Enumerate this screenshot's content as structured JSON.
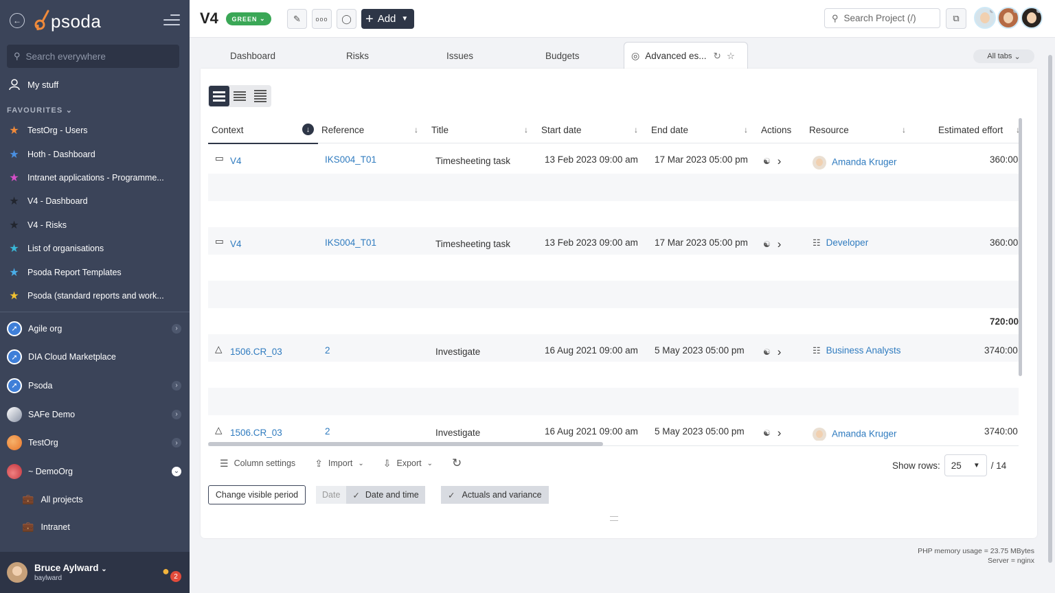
{
  "sidebar": {
    "logo_text": "psoda",
    "search_placeholder": "Search everywhere",
    "my_stuff": "My stuff",
    "favourites_heading": "FAVOURITES",
    "favourites": [
      {
        "label": "TestOrg - Users",
        "color": "#f08a3a"
      },
      {
        "label": "Hoth - Dashboard",
        "color": "#4a90e2"
      },
      {
        "label": "Intranet applications - Programme...",
        "color": "#d64fc8"
      },
      {
        "label": "V4 - Dashboard",
        "color": "#2a2f3a"
      },
      {
        "label": "V4 - Risks",
        "color": "#2a2f3a"
      },
      {
        "label": "List of organisations",
        "color": "#39b8d8"
      },
      {
        "label": "Psoda Report Templates",
        "color": "#4aaee8"
      },
      {
        "label": "Psoda (standard reports and work...",
        "color": "#f2c230"
      }
    ],
    "orgs": [
      {
        "label": "Agile org",
        "icon_color": "#3f7fd8",
        "expanded": false
      },
      {
        "label": "DIA Cloud Marketplace",
        "icon_color": "#3f7fd8",
        "expanded": null
      },
      {
        "label": "Psoda",
        "icon_color": "#3f7fd8",
        "expanded": false
      },
      {
        "label": "SAFe Demo",
        "icon_color": "#e8eaef",
        "expanded": false
      },
      {
        "label": "TestOrg",
        "icon_color": "#f08a3a",
        "expanded": false
      },
      {
        "label": "~ DemoOrg",
        "icon_color": "#d9434e",
        "expanded": true
      }
    ],
    "sub_items": [
      {
        "label": "All projects"
      },
      {
        "label": "Intranet"
      }
    ],
    "user": {
      "name": "Bruce Aylward",
      "handle": "baylward",
      "notifications": "2"
    }
  },
  "topbar": {
    "project": "V4",
    "status": "GREEN",
    "add_label": "Add",
    "search_placeholder": "Search Project (/)"
  },
  "tabs": {
    "items": [
      "Dashboard",
      "Risks",
      "Issues",
      "Budgets"
    ],
    "active": "Advanced es...",
    "all_tabs": "All tabs"
  },
  "grid": {
    "columns": [
      "Context",
      "Reference",
      "Title",
      "Start date",
      "End date",
      "Actions",
      "Resource",
      "Estimated effort"
    ],
    "rows": [
      {
        "context": "V4",
        "context_icon": "project-icon",
        "reference": "IKS004_T01",
        "title": "Timesheeting task",
        "start": "13 Feb 2023 09:00 am",
        "end": "17 Mar 2023 05:00 pm",
        "resource": "Amanda Kruger",
        "resource_type": "person",
        "effort": "360:00"
      },
      {
        "context": "V4",
        "context_icon": "project-icon",
        "reference": "IKS004_T01",
        "title": "Timesheeting task",
        "start": "13 Feb 2023 09:00 am",
        "end": "17 Mar 2023 05:00 pm",
        "resource": "Developer",
        "resource_type": "role",
        "effort": "360:00"
      },
      {
        "context": "1506.CR_03",
        "context_icon": "change-icon",
        "reference": "2",
        "title": "Investigate",
        "start": "16 Aug 2021 09:00 am",
        "end": "5 May 2023 05:00 pm",
        "resource": "Business Analysts",
        "resource_type": "role",
        "effort": "3740:00"
      },
      {
        "context": "1506.CR_03",
        "context_icon": "change-icon",
        "reference": "2",
        "title": "Investigate",
        "start": "16 Aug 2021 09:00 am",
        "end": "5 May 2023 05:00 pm",
        "resource": "Amanda Kruger",
        "resource_type": "person",
        "effort": "3740:00"
      }
    ],
    "subtotal": "720:00"
  },
  "toolbar": {
    "column_settings": "Column settings",
    "import": "Import",
    "export": "Export",
    "show_rows_label": "Show rows:",
    "show_rows_value": "25",
    "total_pages": "/ 14"
  },
  "period": {
    "change_btn": "Change visible period",
    "date": "Date",
    "date_time": "Date and time",
    "actuals": "Actuals and variance"
  },
  "footer": {
    "memory": "PHP memory usage = 23.75 MBytes",
    "server": "Server = nginx"
  }
}
